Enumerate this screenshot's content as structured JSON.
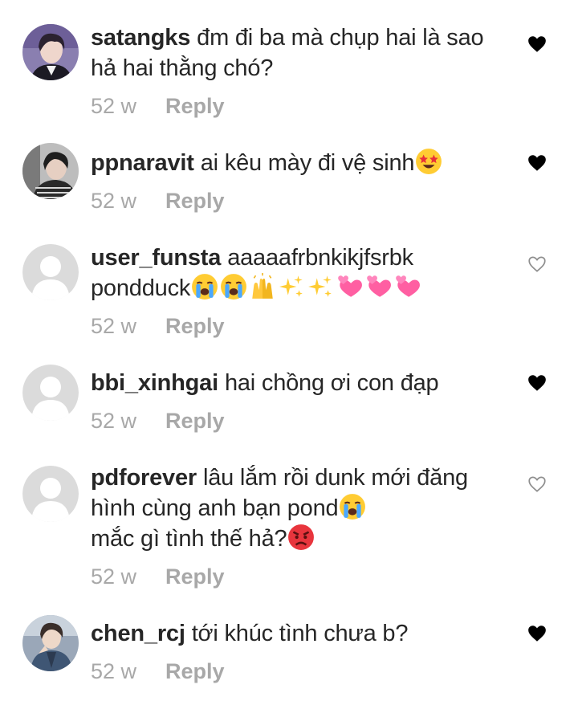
{
  "comments": [
    {
      "username": "satangks",
      "text": "đm đi ba mà chụp hai là sao hả hai thằng chó?",
      "emojis": [],
      "time": "52 w",
      "reply_label": "Reply",
      "liked": true,
      "avatar": "photo-avatar"
    },
    {
      "username": "ppnaravit",
      "text": "ai kêu mày đi vệ sinh",
      "emojis": [
        "star-struck-emoji"
      ],
      "time": "52 w",
      "reply_label": "Reply",
      "liked": true,
      "avatar": "photo-avatar"
    },
    {
      "username": "user_funsta",
      "text": "aaaaafrbnkikjfsrbk pondduck",
      "emojis": [
        "loudly-crying-emoji",
        "loudly-crying-emoji",
        "raising-hands-emoji",
        "sparkles-emoji",
        "sparkles-emoji",
        "two-hearts-emoji",
        "two-hearts-emoji",
        "two-hearts-emoji"
      ],
      "time": "52 w",
      "reply_label": "Reply",
      "liked": false,
      "avatar": "default-avatar"
    },
    {
      "username": "bbi_xinhgai",
      "text": "hai chồng ơi con đạp",
      "emojis": [],
      "time": "52 w",
      "reply_label": "Reply",
      "liked": true,
      "avatar": "default-avatar"
    },
    {
      "username": "pdforever",
      "text": "lâu lắm rồi dunk mới đăng hình cùng anh bạn pond",
      "emojis": [
        "loudly-crying-emoji"
      ],
      "text2": "mắc gì tình thế hả?",
      "emojis2": [
        "pouting-face-emoji"
      ],
      "time": "52 w",
      "reply_label": "Reply",
      "liked": false,
      "avatar": "default-avatar"
    },
    {
      "username": "chen_rcj",
      "text": "tới khúc tình chưa b?",
      "emojis": [],
      "time": "52 w",
      "reply_label": "Reply",
      "liked": true,
      "avatar": "photo-avatar"
    }
  ]
}
